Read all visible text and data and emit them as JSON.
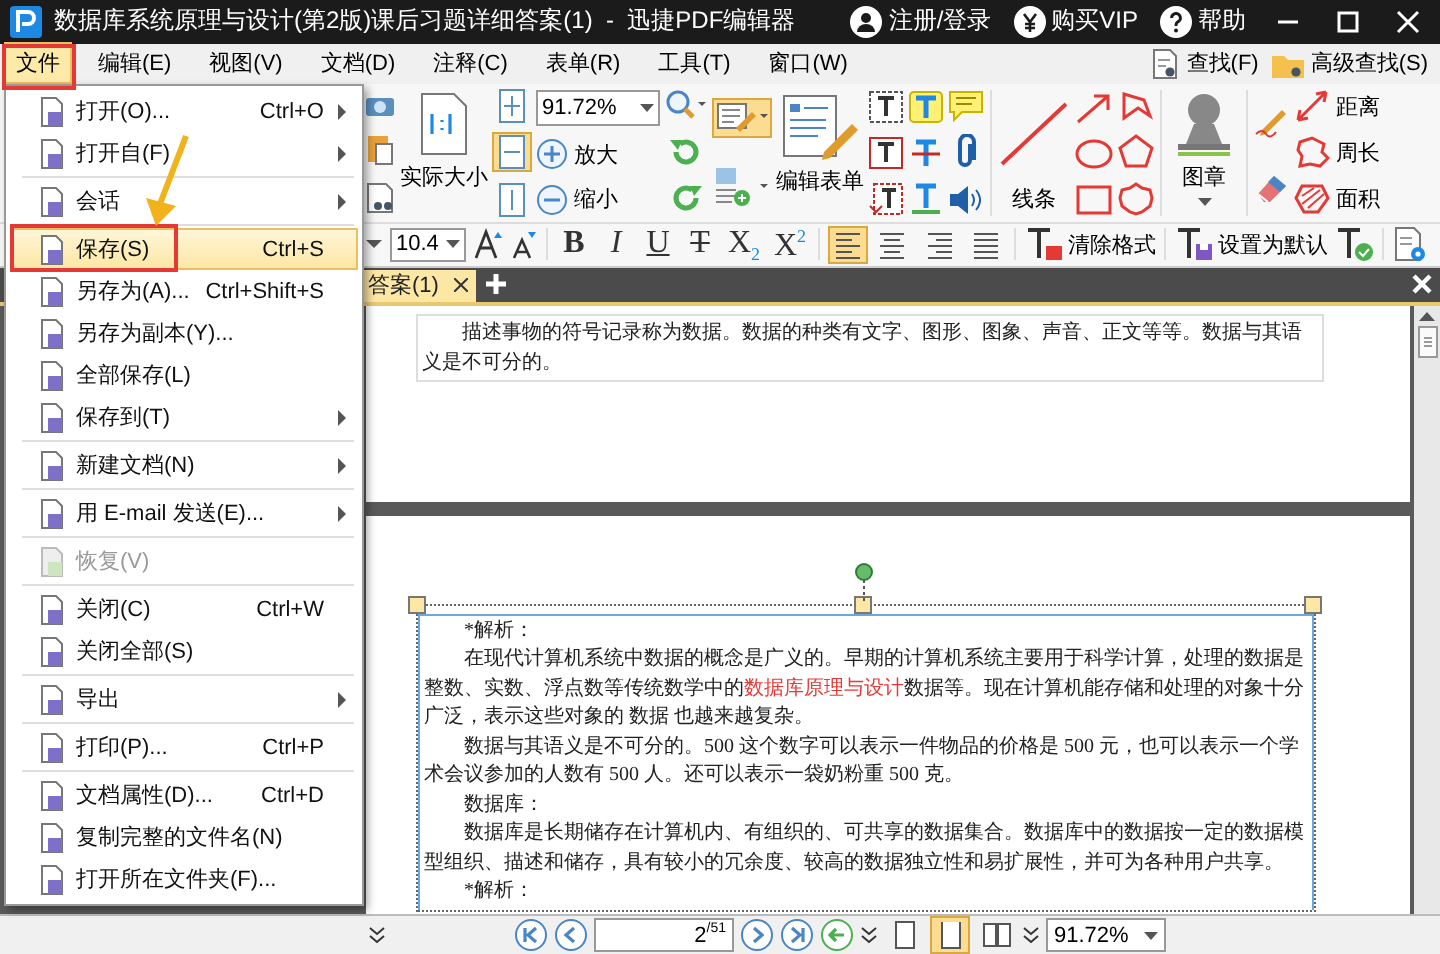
{
  "window": {
    "title": "数据库系统原理与设计(第2版)课后习题详细答案(1)  -  迅捷PDF编辑器",
    "account": "注册/登录",
    "vip": "购买VIP",
    "help": "帮助"
  },
  "menu_bar": {
    "items": [
      {
        "label": "文件",
        "selected": true
      },
      {
        "label": "编辑(E)",
        "selected": false
      },
      {
        "label": "视图(V)",
        "selected": false
      },
      {
        "label": "文档(D)",
        "selected": false
      },
      {
        "label": "注释(C)",
        "selected": false
      },
      {
        "label": "表单(R)",
        "selected": false
      },
      {
        "label": "工具(T)",
        "selected": false
      },
      {
        "label": "窗口(W)",
        "selected": false
      }
    ],
    "find": "查找(F)",
    "advanced_find": "高级查找(S)"
  },
  "ribbon": {
    "actual_size": "实际大小",
    "zoom": "91.72%",
    "zoom_in": "放大",
    "zoom_out": "缩小",
    "edit_form": "编辑表单",
    "line": "线条",
    "stamp": "图章",
    "measure": [
      "距离",
      "周长",
      "面积"
    ]
  },
  "format_bar": {
    "font_size": "10.4",
    "styles": [
      {
        "kind": "bold",
        "label": "B"
      },
      {
        "kind": "italic",
        "label": "I"
      },
      {
        "kind": "underline",
        "label": "U"
      },
      {
        "kind": "strike",
        "label": "T"
      },
      {
        "kind": "script",
        "label": "X$_{2}$"
      },
      {
        "kind": "script",
        "label": "X$^{2}$"
      }
    ],
    "alignment": [
      {
        "selected": true
      },
      {
        "selected": false
      },
      {
        "selected": false
      },
      {
        "selected": false
      }
    ],
    "clear_format": "清除格式",
    "set_default": "设置为默认"
  },
  "tabs": [
    {
      "label": "答案(1)",
      "selected": true
    }
  ],
  "document": {
    "pages": [
      {
        "text_box_selected": false,
        "paragraphs": [
          [
            {
              "text": "描述事物的符号记录称为数据。数据的种类有文字、图形、图象、声音、正文等等。数据与其语义是不可分的。",
              "highlight": false
            }
          ]
        ]
      },
      {
        "text_box_selected": true,
        "paragraphs": [
          [
            {
              "text": "*解析：",
              "highlight": false
            }
          ],
          [
            {
              "text": "在现代计算机系统中数据的概念是广义的。早期的计算机系统主要用于科学计算，处理的数据是整数、实数、浮点数等传统数学中的",
              "highlight": false
            },
            {
              "text": "数据库原理与设计",
              "highlight": true
            },
            {
              "text": "数据等。现在计算机能存储和处理的对象十分广泛，表示这些对象的 数据 也越来越复杂。",
              "highlight": false
            }
          ],
          [
            {
              "text": "数据与其语义是不可分的。500 这个数字可以表示一件物品的价格是 500 元，也可以表示一个学术会议参加的人数有 500 人。还可以表示一袋奶粉重 500 克。",
              "highlight": false
            }
          ],
          [
            {
              "text": "数据库：",
              "highlight": false
            }
          ],
          [
            {
              "text": "数据库是长期储存在计算机内、有组织的、可共享的数据集合。数据库中的数据按一定的数据模型组织、描述和储存，具有较小的冗余度、较高的数据独立性和易扩展性，并可为各种用户共享。",
              "highlight": false
            }
          ],
          [
            {
              "text": "*解析：",
              "highlight": false
            }
          ]
        ]
      }
    ]
  },
  "file_menu": {
    "items": [
      {
        "kind": "item",
        "label": "打开(O)...",
        "shortcut": "Ctrl+O",
        "submenu": true,
        "disabled": false,
        "selected": false
      },
      {
        "kind": "item",
        "label": "打开自(F)",
        "submenu": true,
        "disabled": false,
        "selected": false
      },
      {
        "kind": "separator"
      },
      {
        "kind": "item",
        "label": "会话",
        "submenu": true,
        "disabled": false,
        "selected": false
      },
      {
        "kind": "separator"
      },
      {
        "kind": "item",
        "label": "保存(S)",
        "shortcut": "Ctrl+S",
        "submenu": false,
        "disabled": false,
        "selected": true
      },
      {
        "kind": "item",
        "label": "另存为(A)...",
        "shortcut": "Ctrl+Shift+S",
        "submenu": false,
        "disabled": false,
        "selected": false
      },
      {
        "kind": "item",
        "label": "另存为副本(Y)...",
        "submenu": false,
        "disabled": false,
        "selected": false
      },
      {
        "kind": "item",
        "label": "全部保存(L)",
        "submenu": false,
        "disabled": false,
        "selected": false
      },
      {
        "kind": "item",
        "label": "保存到(T)",
        "submenu": true,
        "disabled": false,
        "selected": false
      },
      {
        "kind": "separator"
      },
      {
        "kind": "item",
        "label": "新建文档(N)",
        "submenu": true,
        "disabled": false,
        "selected": false
      },
      {
        "kind": "separator"
      },
      {
        "kind": "item",
        "label": "用 E-mail 发送(E)...",
        "submenu": true,
        "disabled": false,
        "selected": false
      },
      {
        "kind": "separator"
      },
      {
        "kind": "item",
        "label": "恢复(V)",
        "submenu": false,
        "disabled": true,
        "selected": false
      },
      {
        "kind": "separator"
      },
      {
        "kind": "item",
        "label": "关闭(C)",
        "shortcut": "Ctrl+W",
        "submenu": false,
        "disabled": false,
        "selected": false
      },
      {
        "kind": "item",
        "label": "关闭全部(S)",
        "submenu": false,
        "disabled": false,
        "selected": false
      },
      {
        "kind": "separator"
      },
      {
        "kind": "item",
        "label": "导出",
        "submenu": true,
        "disabled": false,
        "selected": false
      },
      {
        "kind": "separator"
      },
      {
        "kind": "item",
        "label": "打印(P)...",
        "shortcut": "Ctrl+P",
        "submenu": false,
        "disabled": false,
        "selected": false
      },
      {
        "kind": "separator"
      },
      {
        "kind": "item",
        "label": "文档属性(D)...",
        "shortcut": "Ctrl+D",
        "submenu": false,
        "disabled": false,
        "selected": false
      },
      {
        "kind": "item",
        "label": "复制完整的文件名(N)",
        "submenu": false,
        "disabled": false,
        "selected": false
      },
      {
        "kind": "item",
        "label": "打开所在文件夹(F)...",
        "submenu": false,
        "disabled": false,
        "selected": false
      }
    ]
  },
  "status_bar": {
    "page": "2",
    "page_count": "/51",
    "zoom": "91.72%",
    "layout": [
      {
        "selected": false
      },
      {
        "selected": true
      },
      {
        "selected": false
      }
    ]
  }
}
